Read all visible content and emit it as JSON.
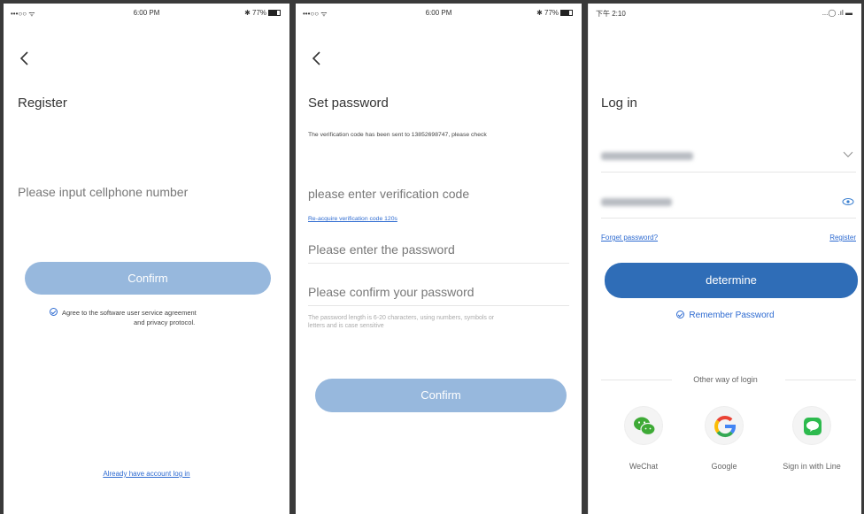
{
  "screen1": {
    "status": {
      "carrier": "•••○○ ᯤ",
      "time": "6:00 PM",
      "battery": "✱ 77%"
    },
    "title": "Register",
    "phone_placeholder": "Please input cellphone number",
    "confirm_label": "Confirm",
    "agreement_line1": "Agree to the software user service agreement",
    "agreement_line2": "and privacy protocol.",
    "login_link": "Already have account log in"
  },
  "screen2": {
    "status": {
      "carrier": "•••○○ ᯤ",
      "time": "6:00 PM",
      "battery": "✱ 77%"
    },
    "title": "Set password",
    "sent_notice": "The verification code has been sent to 13852698747, please check",
    "code_placeholder": "please enter verification code",
    "reacquire_link": "Re-acquire verification code 120s",
    "password_placeholder": "Please enter the password",
    "confirm_password_placeholder": "Please confirm your password",
    "hint_line1": "The password length is 6-20 characters, using numbers, symbols or",
    "hint_line2": "letters and is case sensitive",
    "confirm_label": "Confirm"
  },
  "screen3": {
    "status": {
      "time": "下午 2:10",
      "right": "...◯ .ıl ▬"
    },
    "title": "Log in",
    "forget_link": "Forget password?",
    "register_link": "Register",
    "determine_label": "determine",
    "remember_label": "Remember Password",
    "other_login": "Other way of login",
    "social": [
      {
        "label": "WeChat"
      },
      {
        "label": "Google"
      },
      {
        "label": "Sign in with Line"
      }
    ]
  },
  "colors": {
    "primary": "#2f6db7",
    "primary_faded": "#97b8dd",
    "link": "#2e6bd1"
  }
}
